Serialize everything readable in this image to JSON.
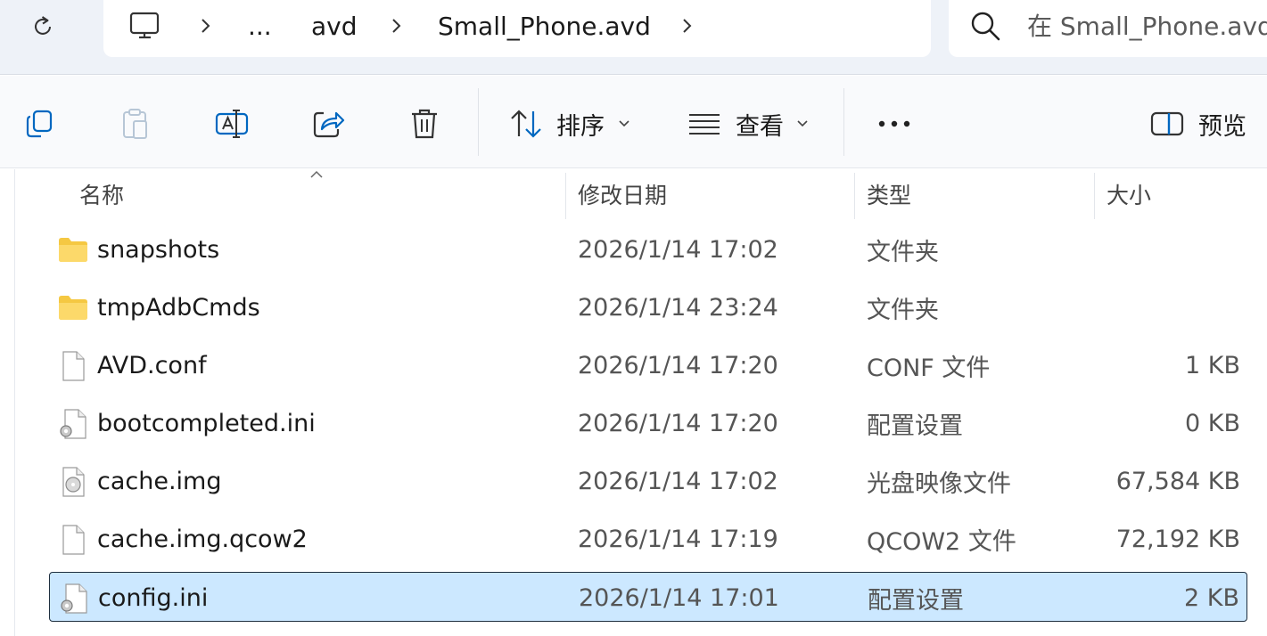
{
  "address_bar": {
    "crumbs": [
      "...",
      "avd",
      "Small_Phone.avd"
    ],
    "search_placeholder": "在 Small_Phone.avd 中搜索"
  },
  "toolbar": {
    "sort_label": "排序",
    "view_label": "查看",
    "preview_label": "预览"
  },
  "columns": {
    "name": "名称",
    "date": "修改日期",
    "type": "类型",
    "size": "大小"
  },
  "files": [
    {
      "name": "snapshots",
      "date": "2026/1/14 17:02",
      "type": "文件夹",
      "size": "",
      "icon": "folder-icon"
    },
    {
      "name": "tmpAdbCmds",
      "date": "2026/1/14 23:24",
      "type": "文件夹",
      "size": "",
      "icon": "folder-icon"
    },
    {
      "name": "AVD.conf",
      "date": "2026/1/14 17:20",
      "type": "CONF 文件",
      "size": "1 KB",
      "icon": "file-icon"
    },
    {
      "name": "bootcompleted.ini",
      "date": "2026/1/14 17:20",
      "type": "配置设置",
      "size": "0 KB",
      "icon": "settings-file-icon"
    },
    {
      "name": "cache.img",
      "date": "2026/1/14 17:02",
      "type": "光盘映像文件",
      "size": "67,584 KB",
      "icon": "disc-image-icon"
    },
    {
      "name": "cache.img.qcow2",
      "date": "2026/1/14 17:19",
      "type": "QCOW2 文件",
      "size": "72,192 KB",
      "icon": "file-icon"
    },
    {
      "name": "config.ini",
      "date": "2026/1/14 17:01",
      "type": "配置设置",
      "size": "2 KB",
      "icon": "settings-file-icon"
    }
  ],
  "selected_file": "config.ini",
  "colors": {
    "selection": "#cce8ff",
    "accent": "#0067c0",
    "folder": "#f5c842"
  }
}
